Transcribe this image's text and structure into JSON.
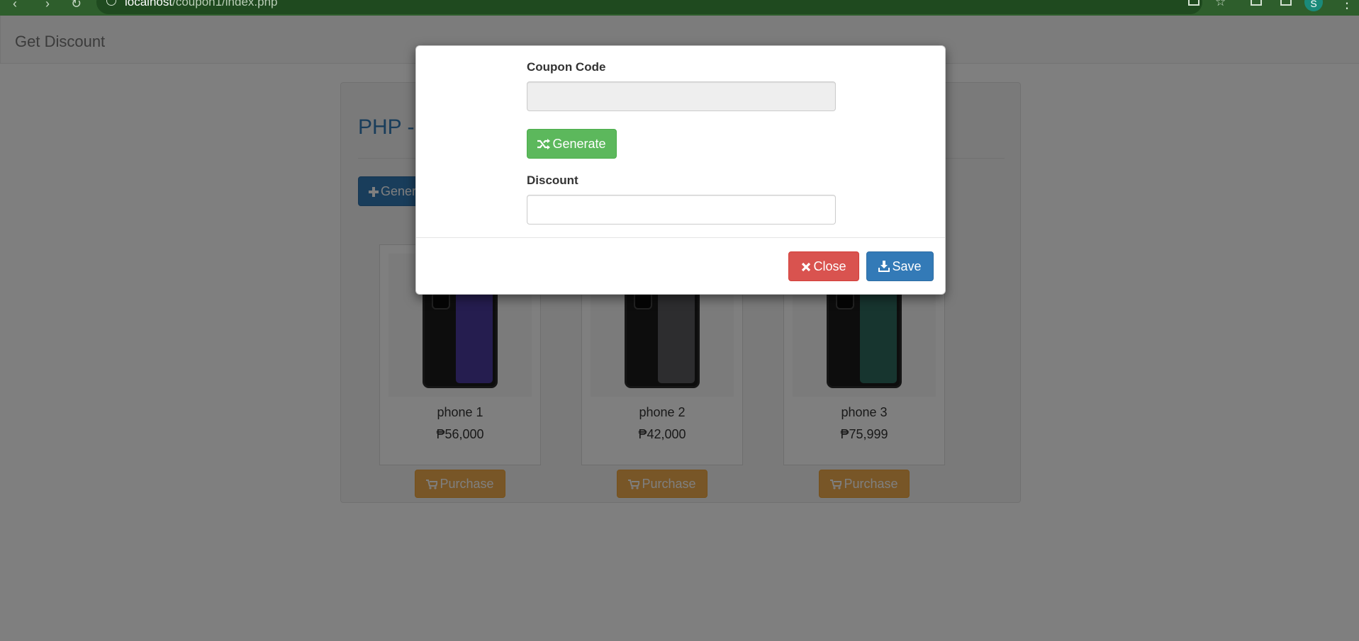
{
  "browser": {
    "url_host": "localhost",
    "url_path": "/coupon1/index.php",
    "avatar_initial": "S"
  },
  "navbar": {
    "brand": "Get Discount"
  },
  "panel": {
    "title": "PHP - ",
    "generate_label": "Generate Coupon"
  },
  "products": [
    {
      "name": "phone 1",
      "price": "₱56,000",
      "purchase_label": "Purchase",
      "image": "redmi-note-12-pro-phone",
      "screen_color": "#4a3a9e"
    },
    {
      "name": "phone 2",
      "price": "₱42,000",
      "purchase_label": "Purchase",
      "image": "dark-grey-phone",
      "screen_color": "#5b5b5e"
    },
    {
      "name": "phone 3",
      "price": "₱75,999",
      "purchase_label": "Purchase",
      "image": "green-phone",
      "screen_color": "#2f6b5e"
    }
  ],
  "modal": {
    "coupon_label": "Coupon Code",
    "coupon_value": "",
    "generate_button": "Generate",
    "discount_label": "Discount",
    "discount_value": "",
    "close_button": "Close",
    "save_button": "Save"
  },
  "colors": {
    "primary": "#337ab7",
    "success": "#5cb85c",
    "danger": "#d9534f",
    "warning": "#f0ad4e",
    "chrome": "#2e5e2c"
  }
}
